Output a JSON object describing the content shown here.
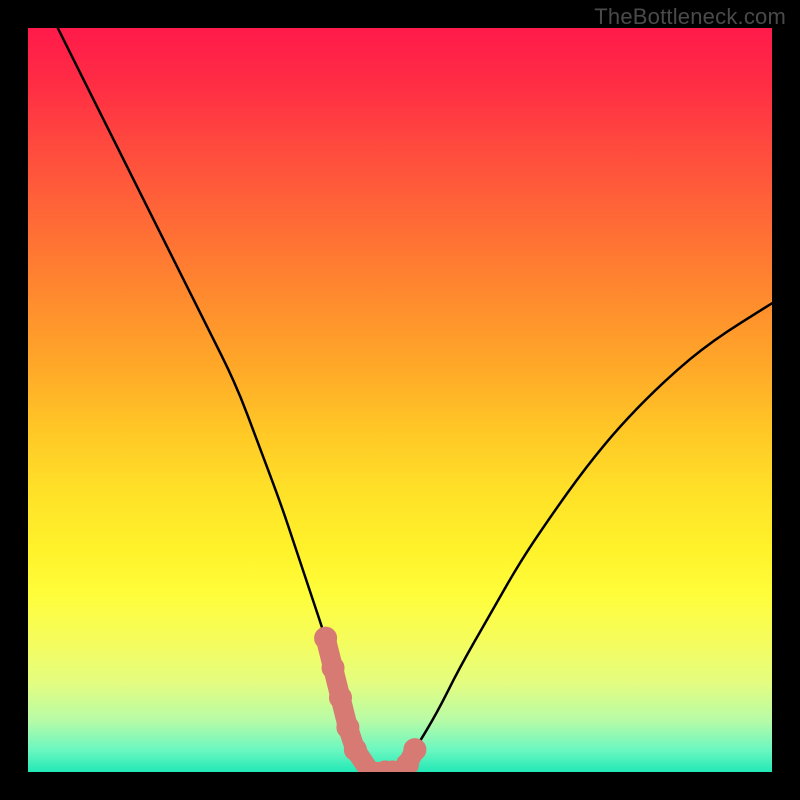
{
  "watermark": "TheBottleneck.com",
  "chart_data": {
    "type": "line",
    "title": "",
    "xlabel": "",
    "ylabel": "",
    "xlim": [
      0,
      100
    ],
    "ylim": [
      0,
      100
    ],
    "series": [
      {
        "name": "bottleneck-curve",
        "x": [
          4,
          8,
          12,
          16,
          20,
          24,
          28,
          31,
          34,
          36,
          38,
          40,
          41,
          42,
          43,
          44,
          46,
          48,
          49,
          50,
          52,
          55,
          58,
          62,
          66,
          70,
          75,
          80,
          86,
          92,
          100
        ],
        "values": [
          100,
          92,
          84,
          76,
          68,
          60,
          52,
          44,
          36,
          30,
          24,
          18,
          14,
          10,
          6,
          3,
          0,
          0,
          0,
          0,
          3,
          8,
          14,
          21,
          28,
          34,
          41,
          47,
          53,
          58,
          63
        ]
      }
    ],
    "marker_region": {
      "x": [
        40,
        41,
        42,
        43,
        44,
        46,
        48,
        49,
        50,
        51,
        52
      ],
      "values": [
        18,
        14,
        10,
        6,
        3,
        0,
        0,
        0,
        0,
        1,
        3
      ]
    },
    "colors": {
      "curve": "#000000",
      "markers": "#d77a74",
      "background_top": "#ff1a4a",
      "background_bottom": "#22e9b6"
    }
  }
}
